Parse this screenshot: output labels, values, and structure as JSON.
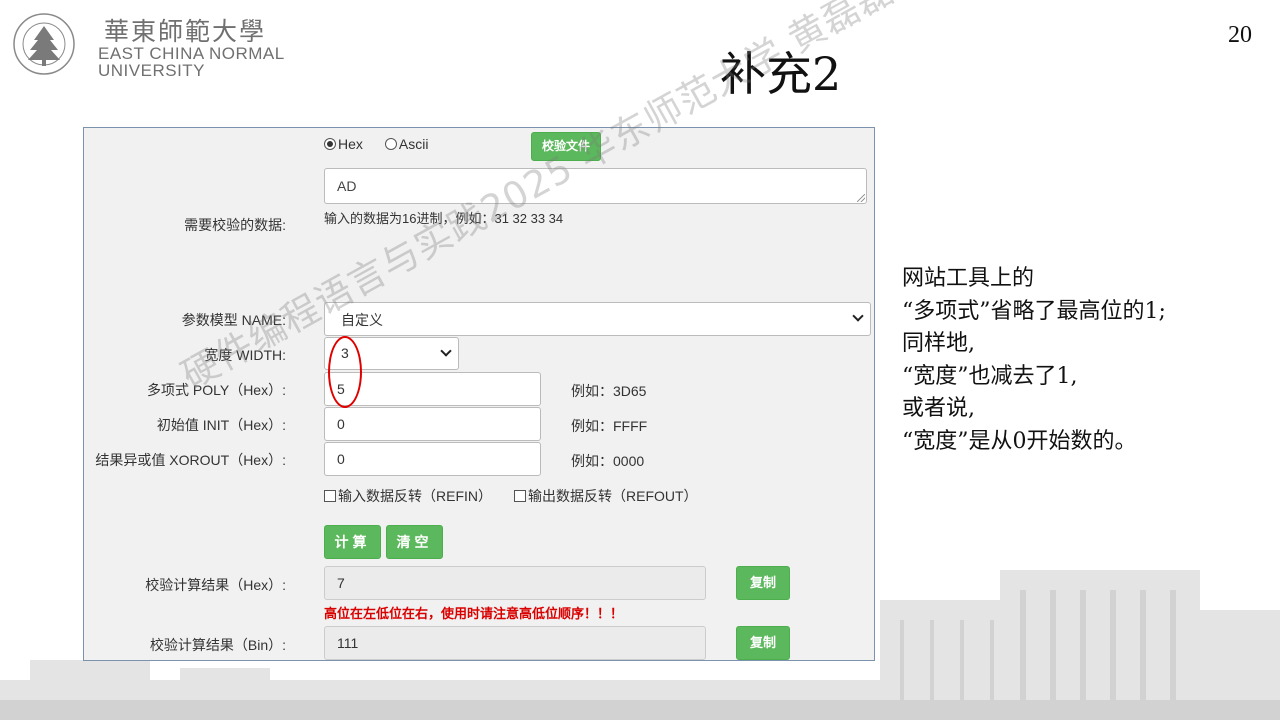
{
  "header": {
    "logo_cn": "華東師範大學",
    "logo_en_line1": "EAST CHINA NORMAL",
    "logo_en_line2": "UNIVERSITY",
    "seal_text": "EAST CHINA NORMAL UNIVERSITY",
    "slide_title": "补充2",
    "page_number": "20"
  },
  "tool": {
    "radio": {
      "hex_label": "Hex",
      "ascii_label": "Ascii",
      "selected": "Hex"
    },
    "check_file_button": "校验文件",
    "data_label": "需要校验的数据:",
    "data_value": "AD",
    "data_hint": "输入的数据为16进制，例如：31 32 33 34",
    "model_label": "参数模型 NAME:",
    "model_value": "自定义",
    "width_label": "宽度 WIDTH:",
    "width_value": "3",
    "poly_label": "多项式 POLY（Hex）:",
    "poly_value": "5",
    "poly_example": "例如：3D65",
    "init_label": "初始值 INIT（Hex）:",
    "init_value": "0",
    "init_example": "例如：FFFF",
    "xorout_label": "结果异或值 XOROUT（Hex）:",
    "xorout_value": "0",
    "xorout_example": "例如：0000",
    "refin_label": "输入数据反转（REFIN）",
    "refout_label": "输出数据反转（REFOUT）",
    "calc_button": "计算",
    "clear_button": "清空",
    "result_hex_label": "校验计算结果（Hex）:",
    "result_hex_value": "7",
    "copy_button": "复制",
    "warning": "高位在左低位在右，使用时请注意高低位顺序！！！",
    "result_bin_label": "校验计算结果（Bin）:",
    "result_bin_value": "111"
  },
  "watermark": "硬件编程语言与实践2025 华东师范大学 黄磊磊",
  "note_lines": [
    "网站工具上的",
    "“多项式”省略了最高位的1;",
    "同样地,",
    "“宽度”也减去了1,",
    "或者说,",
    "“宽度”是从0开始数的。"
  ],
  "colors": {
    "button_green": "#5cb85c",
    "warning_red": "#d90000",
    "annotation_red": "#e00000",
    "logo_gray": "#707070",
    "panel_border": "#7b93ad"
  }
}
